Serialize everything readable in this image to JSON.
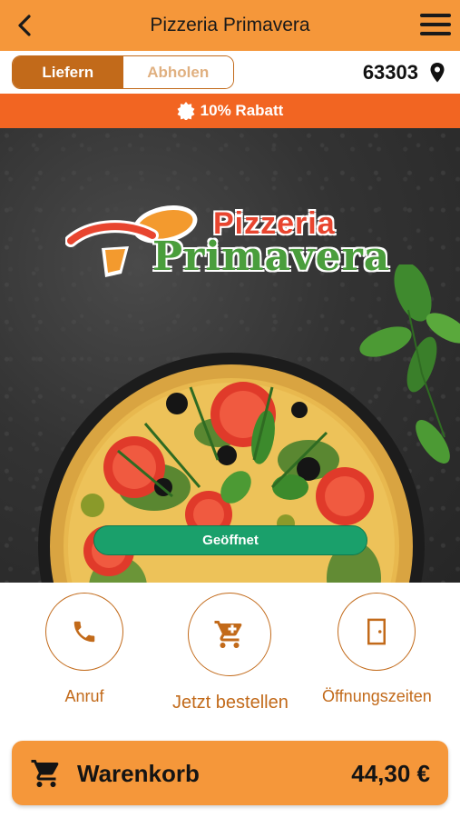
{
  "header": {
    "title": "Pizzeria Primavera",
    "back_icon": "chevron-left-icon",
    "menu_icon": "hamburger-menu-icon"
  },
  "mode_toggle": {
    "options": [
      {
        "label": "Liefern",
        "active": true
      },
      {
        "label": "Abholen",
        "active": false
      }
    ]
  },
  "location": {
    "zip": "63303",
    "icon": "map-pin-icon"
  },
  "discount_banner": {
    "text": "10% Rabatt",
    "icon": "badge-icon"
  },
  "hero": {
    "logo_line1": "Pizzeria",
    "logo_line2": "Primavera",
    "status_button": "Geöffnet"
  },
  "actions": [
    {
      "label": "Anruf",
      "icon": "phone-icon"
    },
    {
      "label": "Jetzt bestellen",
      "icon": "cart-icon"
    },
    {
      "label": "Öffnungszeiten",
      "icon": "door-icon"
    }
  ],
  "cart": {
    "label": "Warenkorb",
    "total": "44,30 €",
    "icon": "cart-icon"
  },
  "colors": {
    "primary_orange": "#f5973a",
    "brand_brown": "#c26a1a",
    "discount_red": "#f26522",
    "open_green": "#1aa06b"
  }
}
